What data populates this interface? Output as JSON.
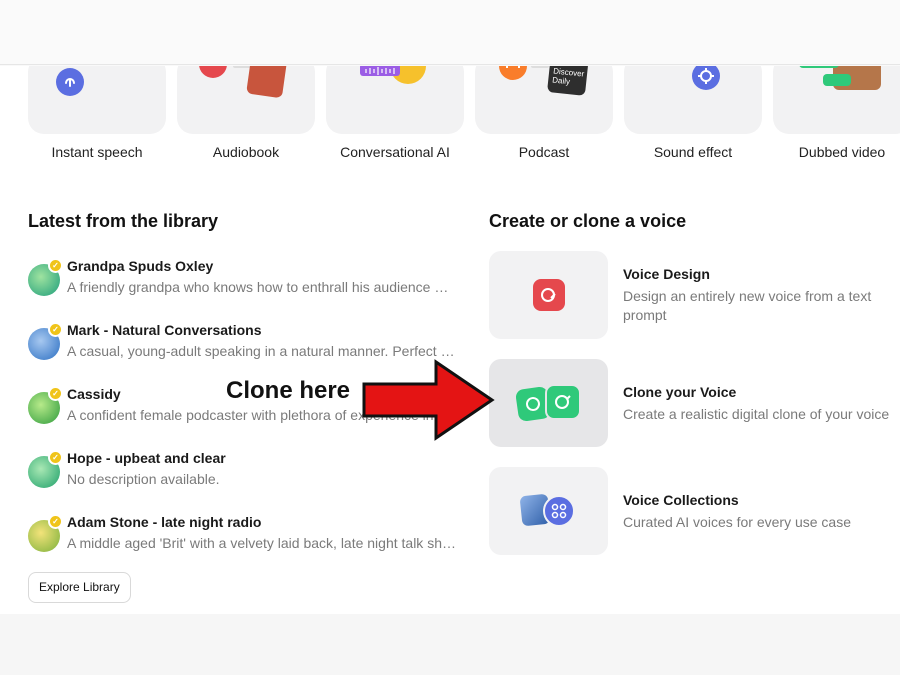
{
  "tiles": [
    {
      "label": "Instant speech",
      "icon": "microphone-icon"
    },
    {
      "label": "Audiobook",
      "icon": "headphones-icon"
    },
    {
      "label": "Conversational AI",
      "icon": "waveform-icon"
    },
    {
      "label": "Podcast",
      "icon": "headphones-icon",
      "cover_text": "Discover Daily"
    },
    {
      "label": "Sound effect",
      "icon": "sparkle-icon"
    },
    {
      "label": "Dubbed video",
      "icon": "waveform-icon"
    }
  ],
  "library": {
    "title": "Latest from the library",
    "items": [
      {
        "name": "Grandpa Spuds Oxley",
        "desc": "A friendly grandpa who knows how to enthrall his audience with tall tales"
      },
      {
        "name": "Mark - Natural Conversations",
        "desc": "A casual, young-adult speaking in a natural manner. Perfect for conversations"
      },
      {
        "name": "Cassidy",
        "desc": "A confident female podcaster with plethora of experience in the industry"
      },
      {
        "name": "Hope - upbeat and clear",
        "desc": "No description available."
      },
      {
        "name": "Adam Stone - late night radio",
        "desc": "A middle aged 'Brit' with a velvety laid back, late night talk show host timbre"
      }
    ],
    "explore_label": "Explore Library"
  },
  "voices": {
    "title": "Create or clone a voice",
    "options": [
      {
        "title": "Voice Design",
        "desc": "Design an entirely new voice from a text prompt",
        "icon": "voice-design-icon"
      },
      {
        "title": "Clone your Voice",
        "desc": "Create a realistic digital clone of your voice",
        "icon": "voice-clone-icon"
      },
      {
        "title": "Voice Collections",
        "desc": "Curated AI voices for every use case",
        "icon": "collections-icon"
      }
    ]
  },
  "annotation": {
    "label": "Clone here",
    "arrow_color": "#e41414"
  },
  "colors": {
    "red": "#e5484d",
    "green": "#2fc97a",
    "blue": "#5b6ee1",
    "orange": "#f97d2b",
    "purple": "#9b5de5",
    "badge": "#f0c419"
  }
}
